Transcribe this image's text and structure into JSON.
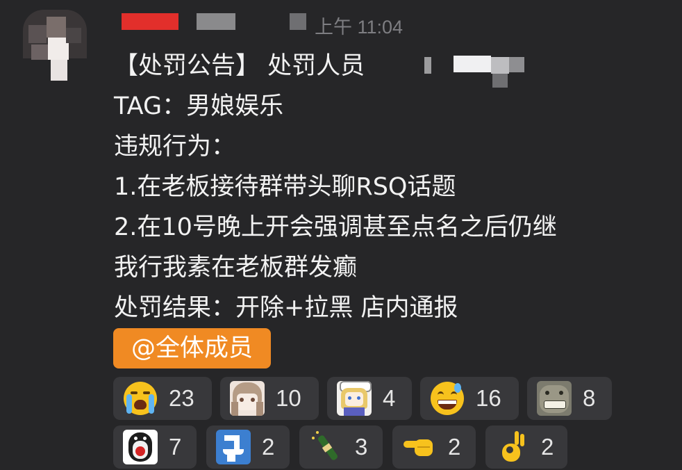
{
  "header": {
    "timestamp": "上午 11:04"
  },
  "message": {
    "lines": [
      "【处罚公告】 处罚人员",
      "TAG：男娘娱乐",
      "违规行为：",
      "1.在老板接待群带头聊RSQ话题",
      "2.在10号晚上开会强调甚至点名之后仍继",
      "我行我素在老板群发癫",
      "处罚结果：开除+拉黑 店内通报"
    ],
    "mention": "@全体成员"
  },
  "reactions": [
    {
      "icon": "crying-face-icon",
      "count": "23"
    },
    {
      "icon": "anime-girl-sticker-icon",
      "count": "10"
    },
    {
      "icon": "anime-maid-sticker-icon",
      "count": "4"
    },
    {
      "icon": "sweat-smile-icon",
      "count": "16"
    },
    {
      "icon": "grinning-dog-sticker-icon",
      "count": "8"
    },
    {
      "icon": "penguin-sticker-icon",
      "count": "7"
    },
    {
      "icon": "toilet-icon",
      "count": "2"
    },
    {
      "icon": "champagne-icon",
      "count": "3"
    },
    {
      "icon": "pointing-hand-icon",
      "count": "2"
    },
    {
      "icon": "ok-hand-icon",
      "count": "2"
    }
  ],
  "colors": {
    "background": "#262628",
    "mention_bg": "#f08a23",
    "chip_bg": "#38383b",
    "redact_red": "#e22f2b"
  }
}
